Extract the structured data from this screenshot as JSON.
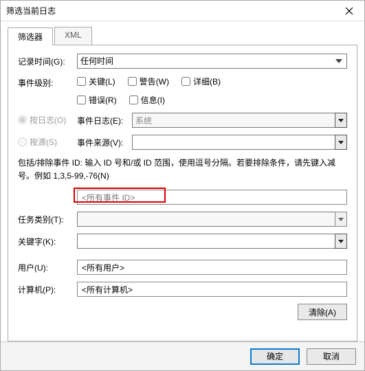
{
  "window": {
    "title": "筛选当前日志"
  },
  "tabs": {
    "filter": "筛选器",
    "xml": "XML"
  },
  "labels": {
    "logged": "记录时间(G):",
    "event_level": "事件级别:",
    "by_log": "按日志(O)",
    "by_source": "按源(S)",
    "event_log": "事件日志(E):",
    "event_source": "事件来源(V):",
    "task_category": "任务类别(T):",
    "keywords": "关键字(K):",
    "user": "用户(U):",
    "computer": "计算机(P):"
  },
  "logged_options": {
    "any_time": "任何时间"
  },
  "levels": {
    "critical": "关键(L)",
    "warning": "警告(W)",
    "verbose": "详细(B)",
    "error": "错误(R)",
    "information": "信息(I)"
  },
  "event_log_value": "系统",
  "include_exclude_help": "包括/排除事件 ID: 输入 ID 号和/或 ID 范围，使用逗号分隔。若要排除条件，请先键入减号。例如 1,3,5-99,-76(N)",
  "event_id_placeholder": "<所有事件 ID>",
  "user_value": "<所有用户>",
  "computer_value": "<所有计算机>",
  "buttons": {
    "clear": "清除(A)",
    "ok": "确定",
    "cancel": "取消"
  }
}
